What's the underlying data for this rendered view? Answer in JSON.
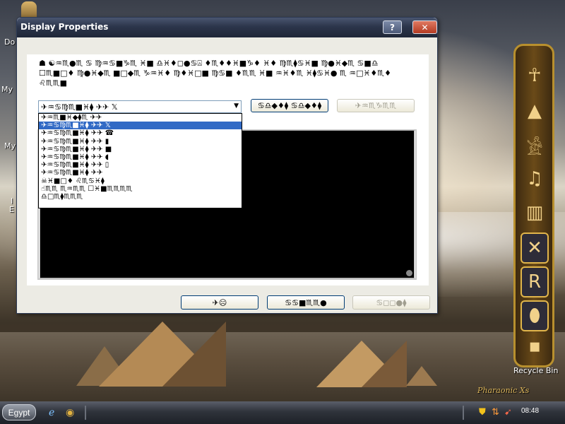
{
  "desktop": {
    "labels": [
      "Do",
      "My",
      "My",
      "I",
      "E"
    ],
    "recycle_bin": "Recycle Bin",
    "brand": "Pharaonic Xs"
  },
  "dock": {
    "items": [
      {
        "name": "pharaoh-mask-icon",
        "glyph": "☥"
      },
      {
        "name": "pyramids-icon",
        "glyph": "▲"
      },
      {
        "name": "scribe-icon",
        "glyph": "𓀀"
      },
      {
        "name": "harp-icon",
        "glyph": "♫"
      },
      {
        "name": "book-icon",
        "glyph": "▥"
      },
      {
        "name": "tools-icon",
        "glyph": "✕"
      },
      {
        "name": "r-tools-icon",
        "glyph": "R"
      },
      {
        "name": "cartouche-icon",
        "glyph": "⬮"
      },
      {
        "name": "small-item-icon",
        "glyph": "▪"
      }
    ]
  },
  "window": {
    "title": "Display Properties",
    "help_label": "?",
    "close_label": "✕",
    "description": "☗ ☯♒♏●♏ ♋ ♍♒♋■♑♏ ♓■ ♎♓♦◻●♋⍓ ♦♏♦♦♓■♑♦ ♓♦ ♍♏⧫♋♓■ ♍●♓◆♏ ♋■♎ ☐♏■□♦ ♍●♓◆♏ ■□◆♏ ♑♒♓♦ ♍♦♓□■ ♍♋■ ♦♏♏ ♓■ ♒♓♦♏ ♓⧫♋♓● ♏ ♒□♓♦♏♦ ♌♏♏■",
    "combo_value": "✈♒♋♍♏■♓⧫ ✈✈ 𝕏",
    "settings_button": "♋♎◆♦⧫ ♋♎◆♦⧫",
    "preview_button": "✈♒♏♑♏♏",
    "dropdown_items": [
      "✈♒♏■♓◆⧫♏ ✈✈",
      "✈♒♋♍♏■♓⧫ ✈✈ 𝕏",
      "✈♒♋♍♏■♓⧫ ✈✈ ☎",
      "✈♒♋♍♏■♓⧫ ✈✈ ▮",
      "✈♒♋♍♏■♓⧫ ✈✈ ■",
      "✈♒♋♍♏■♓⧫ ✈✈ ◖",
      "✈♒♋♍♏■♓⧫ ✈✈ ▯",
      "✈♒♋♍♏■♓⧫ ✈✈",
      "☠♓■□♦ ♌♏♋♓⧫",
      "☝♏♏ ♏♒♏♏ ☐♓■♏♏♏♏",
      "♎□♏⧫♏♏♏"
    ],
    "footer": {
      "ok": "✈☹",
      "cancel": "♋♋■♏♏●",
      "apply": "♋◻◻●⧫"
    }
  },
  "taskbar": {
    "start_label": "Egypt",
    "clock": "08:48",
    "quick_launch": [
      "internet-explorer-icon",
      "eye-of-ra-icon"
    ]
  },
  "colors": {
    "titlebar": "#2c354b",
    "selection": "#316ac5",
    "dock_border": "#b8902e"
  }
}
